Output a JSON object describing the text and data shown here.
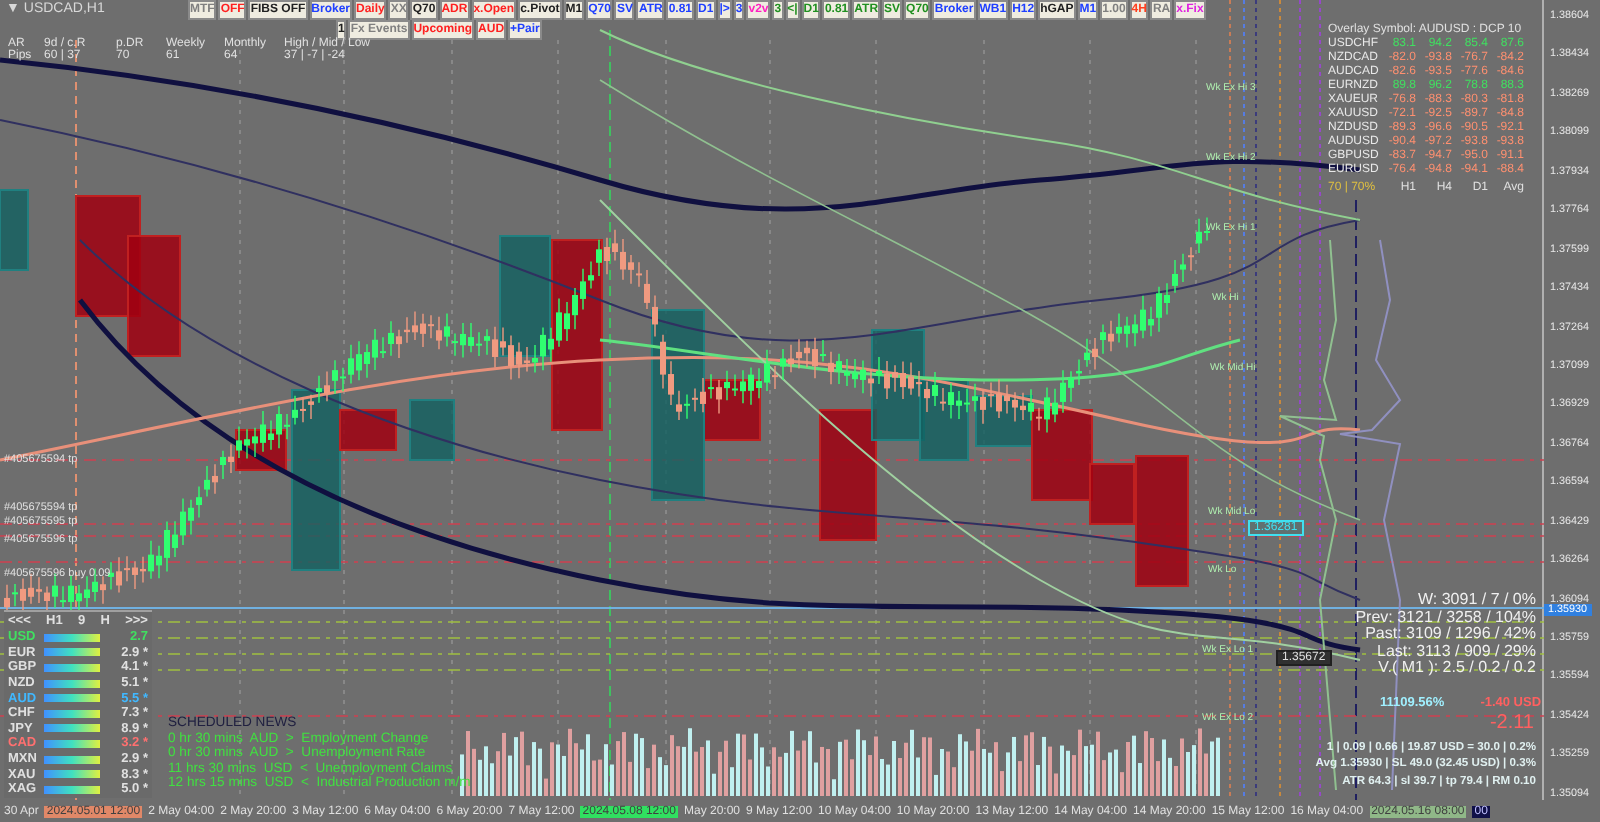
{
  "title_glyph": "▼",
  "chart_title": "USDCAD,H1",
  "toolbar_row_1": [
    {
      "label": "MTF",
      "color": "#808080"
    },
    {
      "label": "OFF",
      "color": "#ff2020"
    },
    {
      "label": "FIBS OFF",
      "color": "#202020"
    },
    {
      "label": "Broker",
      "color": "#2040ff"
    },
    {
      "label": "Daily",
      "color": "#ff2020"
    },
    {
      "label": "XX",
      "color": "#808080"
    },
    {
      "label": "Q70",
      "color": "#202020"
    },
    {
      "label": "ADR",
      "color": "#ff2020"
    },
    {
      "label": "x.Open",
      "color": "#ff2020"
    },
    {
      "label": "c.Pivot",
      "color": "#202020"
    },
    {
      "label": "M1",
      "color": "#202020"
    },
    {
      "label": "Q70",
      "color": "#2040ff"
    },
    {
      "label": "SV",
      "color": "#2040ff"
    },
    {
      "label": "ATR",
      "color": "#2040ff"
    },
    {
      "label": "0.81",
      "color": "#2040ff"
    },
    {
      "label": "D1",
      "color": "#2040ff"
    },
    {
      "label": "|>",
      "color": "#2040ff"
    },
    {
      "label": "3",
      "color": "#2040ff"
    },
    {
      "label": "v2v",
      "color": "#ff20c0"
    },
    {
      "label": "3",
      "color": "#209020"
    },
    {
      "label": "<|",
      "color": "#209020"
    },
    {
      "label": "D1",
      "color": "#209020"
    },
    {
      "label": "0.81",
      "color": "#209020"
    },
    {
      "label": "ATR",
      "color": "#209020"
    },
    {
      "label": "SV",
      "color": "#209020"
    },
    {
      "label": "Q70",
      "color": "#209020"
    },
    {
      "label": "Broker",
      "color": "#2040ff"
    },
    {
      "label": "WB1",
      "color": "#2040ff"
    },
    {
      "label": "H12",
      "color": "#2040ff"
    },
    {
      "label": "hGAP",
      "color": "#202020"
    },
    {
      "label": "M1",
      "color": "#2040ff"
    },
    {
      "label": "1.00",
      "color": "#808080"
    },
    {
      "label": "4H",
      "color": "#ff4020"
    },
    {
      "label": "RA",
      "color": "#808080"
    },
    {
      "label": "x.Fix",
      "color": "#e020e0"
    }
  ],
  "toolbar_row_2": [
    {
      "label": "1",
      "color": "#202020"
    },
    {
      "label": "Fx Events",
      "color": "#808080"
    },
    {
      "label": "Upcoming",
      "color": "#ff2020"
    },
    {
      "label": "AUD",
      "color": "#ff2020"
    },
    {
      "label": "+Pair",
      "color": "#2040ff"
    }
  ],
  "range_table": {
    "headers": [
      "AR",
      "9d / c.R",
      "p.DR",
      "Weekly",
      "Monthly",
      "High / Mid / Low"
    ],
    "values": [
      "Pips",
      "60 | 37",
      "70",
      "61",
      "64",
      "37 | -7 | -24"
    ]
  },
  "overlay": {
    "title": "Overlay Symbol: AUDUSD : DCP 10",
    "rows": [
      {
        "symbol": "USDCHF",
        "values": [
          "83.1",
          "94.2",
          "85.4",
          "87.6"
        ],
        "color": "#40e060"
      },
      {
        "symbol": "NZDCAD",
        "values": [
          "-82.0",
          "-93.8",
          "-76.7",
          "-84.2"
        ],
        "color": "#ff9070"
      },
      {
        "symbol": "AUDCAD",
        "values": [
          "-82.6",
          "-93.5",
          "-77.6",
          "-84.6"
        ],
        "color": "#ff9070"
      },
      {
        "symbol": "EURNZD",
        "values": [
          "89.8",
          "96.2",
          "78.8",
          "88.3"
        ],
        "color": "#40e060"
      },
      {
        "symbol": "XAUEUR",
        "values": [
          "-76.8",
          "-88.3",
          "-80.3",
          "-81.8"
        ],
        "color": "#ff9070"
      },
      {
        "symbol": "XAUUSD",
        "values": [
          "-72.1",
          "-92.5",
          "-89.7",
          "-84.8"
        ],
        "color": "#ff9070"
      },
      {
        "symbol": "NZDUSD",
        "values": [
          "-89.3",
          "-96.6",
          "-90.5",
          "-92.1"
        ],
        "color": "#ff9070"
      },
      {
        "symbol": "AUDUSD",
        "values": [
          "-90.4",
          "-97.2",
          "-93.8",
          "-93.8"
        ],
        "color": "#ff9070"
      },
      {
        "symbol": "GBPUSD",
        "values": [
          "-83.7",
          "-94.7",
          "-95.0",
          "-91.1"
        ],
        "color": "#ff9070"
      },
      {
        "symbol": "EURUSD",
        "values": [
          "-76.4",
          "-94.8",
          "-94.1",
          "-88.4"
        ],
        "color": "#ff9070"
      }
    ],
    "footer": [
      "70 | 70%",
      "H1",
      "H4",
      "D1",
      "Avg"
    ]
  },
  "order_labels": [
    "#405675594 tp",
    "#405675594 tp",
    "#405675595 tp",
    "#405675596 tp",
    "#405675596 buy 0.09"
  ],
  "level_labels": [
    "Wk Ex Hi 3",
    "Wk Ex Hi 2",
    "Wk Ex Hi 1",
    "Wk Hi",
    "Wk Mid Hi",
    "Wk Mid Lo",
    "Wk Lo",
    "Wk Ex Lo 1",
    "Wk Ex Lo 2"
  ],
  "price_tags": [
    {
      "text": "1.36281",
      "kind": "cyan"
    },
    {
      "text": "1.35672",
      "kind": "dark"
    }
  ],
  "price_axis": [
    "1.38604",
    "1.38434",
    "1.38269",
    "1.38099",
    "1.37934",
    "1.37764",
    "1.37599",
    "1.37434",
    "1.37264",
    "1.37099",
    "1.36929",
    "1.36764",
    "1.36594",
    "1.36429",
    "1.36264",
    "1.36094",
    "1.35759",
    "1.35594",
    "1.35424",
    "1.35259",
    "1.35094"
  ],
  "current_price": "1.35930",
  "trade_stats": [
    "W: 3091 / 7 / 0%",
    "Prev: 3121 / 3258 / 104%",
    "Past: 3109 / 1296 / 42%",
    "Last: 3113 / 909 / 29%",
    "V.( M1 ): 2.5 / 0.2 / 0.2"
  ],
  "pnl": {
    "percent": "11109.56%",
    "usd": "-1.40 USD",
    "pips": "-2.11"
  },
  "risk_lines": [
    "1  |  0.09  |  0.66  |  19.87 USD = 30.0  |  0.2%",
    "Avg 1.35930  |  SL 49.0 (32.45 USD)  |  0.3%",
    "ATR 64.3  |  sl 39.7  |  tp 79.4  |  RM 0.10"
  ],
  "strength": {
    "header": [
      "<<<",
      "H1",
      "9",
      "H",
      ">>>"
    ],
    "currencies": [
      {
        "name": "USD",
        "value": "2.7",
        "color": "#40e060"
      },
      {
        "name": "EUR",
        "value": "2.9 *",
        "color": "#e0e0e0"
      },
      {
        "name": "GBP",
        "value": "4.1 *",
        "color": "#e0e0e0"
      },
      {
        "name": "NZD",
        "value": "5.1 *",
        "color": "#e0e0e0"
      },
      {
        "name": "AUD",
        "value": "5.5 *",
        "color": "#40b8ff"
      },
      {
        "name": "CHF",
        "value": "7.3 *",
        "color": "#e0e0e0"
      },
      {
        "name": "JPY",
        "value": "8.9 *",
        "color": "#e0e0e0"
      },
      {
        "name": "CAD",
        "value": "3.2 *",
        "color": "#ff7070"
      },
      {
        "name": "MXN",
        "value": "2.9 *",
        "color": "#e0e0e0"
      },
      {
        "name": "XAU",
        "value": "8.3 *",
        "color": "#e0e0e0"
      },
      {
        "name": "XAG",
        "value": "5.0 *",
        "color": "#e0e0e0"
      }
    ]
  },
  "news": {
    "title": "SCHEDULED NEWS",
    "items": [
      "0 hr 30 mins  AUD  >  Employment Change",
      "0 hr 30 mins  AUD  >  Unemployment Rate",
      "11 hrs 30 mins  USD  <  Unemployment Claims",
      "12 hrs 15 mins  USD  <  Industrial Production m/m"
    ]
  },
  "time_axis": [
    {
      "label": "30 Apr",
      "kind": "plain"
    },
    {
      "label": "2024.05.01 12:00",
      "kind": "highlight",
      "color": "#e08868"
    },
    {
      "label": "2 May 04:00",
      "kind": "plain"
    },
    {
      "label": "2 May 20:00",
      "kind": "plain"
    },
    {
      "label": "3 May 12:00",
      "kind": "plain"
    },
    {
      "label": "6 May 04:00",
      "kind": "plain"
    },
    {
      "label": "6 May 20:00",
      "kind": "plain"
    },
    {
      "label": "7 May 12:00",
      "kind": "plain"
    },
    {
      "label": "2024.05.08 12:00",
      "kind": "highlight",
      "color": "#30e060"
    },
    {
      "label": "May 20:00",
      "kind": "plain"
    },
    {
      "label": "9 May 12:00",
      "kind": "plain"
    },
    {
      "label": "10 May 04:00",
      "kind": "plain"
    },
    {
      "label": "10 May 20:00",
      "kind": "plain"
    },
    {
      "label": "13 May 12:00",
      "kind": "plain"
    },
    {
      "label": "14 May 04:00",
      "kind": "plain"
    },
    {
      "label": "14 May 20:00",
      "kind": "plain"
    },
    {
      "label": "15 May 12:00",
      "kind": "plain"
    },
    {
      "label": "16 May 04:00",
      "kind": "plain"
    },
    {
      "label": "2024.05.16 08:00",
      "kind": "highlight",
      "color": "#90b888"
    },
    {
      "label": "00",
      "kind": "highlight",
      "color": "#101048"
    }
  ]
}
